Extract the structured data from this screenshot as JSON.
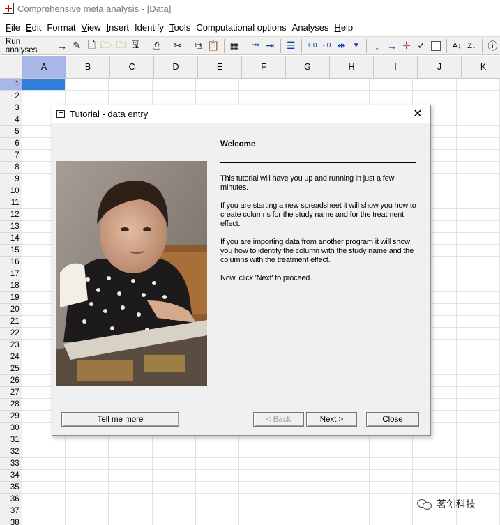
{
  "window": {
    "title": "Comprehensive meta analysis - [Data]",
    "icon": "app-icon"
  },
  "menu": {
    "items": [
      {
        "label": "File",
        "accel": "F"
      },
      {
        "label": "Edit",
        "accel": "E"
      },
      {
        "label": "Format",
        "accel": ""
      },
      {
        "label": "View",
        "accel": "V"
      },
      {
        "label": "Insert",
        "accel": "I"
      },
      {
        "label": "Identify",
        "accel": ""
      },
      {
        "label": "Tools",
        "accel": "T"
      },
      {
        "label": "Computational options",
        "accel": ""
      },
      {
        "label": "Analyses",
        "accel": ""
      },
      {
        "label": "Help",
        "accel": "H"
      }
    ]
  },
  "toolbar": {
    "run_label": "Run analyses",
    "icons": [
      "arrow-right-icon",
      "pencil-icon",
      "new-file-icon",
      "open-folder-icon",
      "folder-icon",
      "save-icon",
      "print-icon",
      "cut-icon",
      "copy-icon",
      "paste-icon",
      "table-icon",
      "indent-decrease-icon",
      "indent-increase-icon",
      "list-icon",
      "increase-decimal-icon",
      "decrease-decimal-icon",
      "column-width-icon",
      "dropdown-icon",
      "arrow-down-icon",
      "arrow-right-blue-icon",
      "cross-icon",
      "checkmark-icon",
      "checkbox-icon",
      "sort-ascending-icon",
      "sort-descending-icon",
      "info-icon"
    ]
  },
  "sheet": {
    "columns": [
      "A",
      "B",
      "C",
      "D",
      "E",
      "F",
      "G",
      "H",
      "I",
      "J",
      "K"
    ],
    "rows": [
      "1",
      "2",
      "3",
      "4",
      "5",
      "6",
      "7",
      "8",
      "9",
      "10",
      "11",
      "12",
      "13",
      "14",
      "15",
      "16",
      "17",
      "18",
      "19",
      "20",
      "21",
      "22",
      "23",
      "24",
      "25",
      "26",
      "27",
      "28",
      "29",
      "30",
      "31",
      "32",
      "33",
      "34",
      "35",
      "36",
      "37",
      "38"
    ],
    "selected_cell": "A1"
  },
  "dialog": {
    "title": "Tutorial - data entry",
    "heading": "Welcome",
    "paragraphs": [
      "This tutorial will have you up and running in just a few minutes.",
      "If you are starting a new spreadsheet it will show you how to create columns for the study name and for the treatment effect.",
      "If you are importing data from another program it will show you how to identify the column with the study name and the columns with the treatment effect.",
      "Now, click 'Next' to proceed."
    ],
    "buttons": {
      "tell_me_more": "Tell me more",
      "back": "< Back",
      "next": "Next >",
      "close": "Close"
    }
  },
  "watermark": {
    "text": "茗创科技"
  },
  "colors": {
    "selection_header": "#a6b7e8",
    "active_cell": "#2f7fd8",
    "toolbar_blue": "#0b3ea8",
    "toolbar_red": "#b0151c"
  }
}
